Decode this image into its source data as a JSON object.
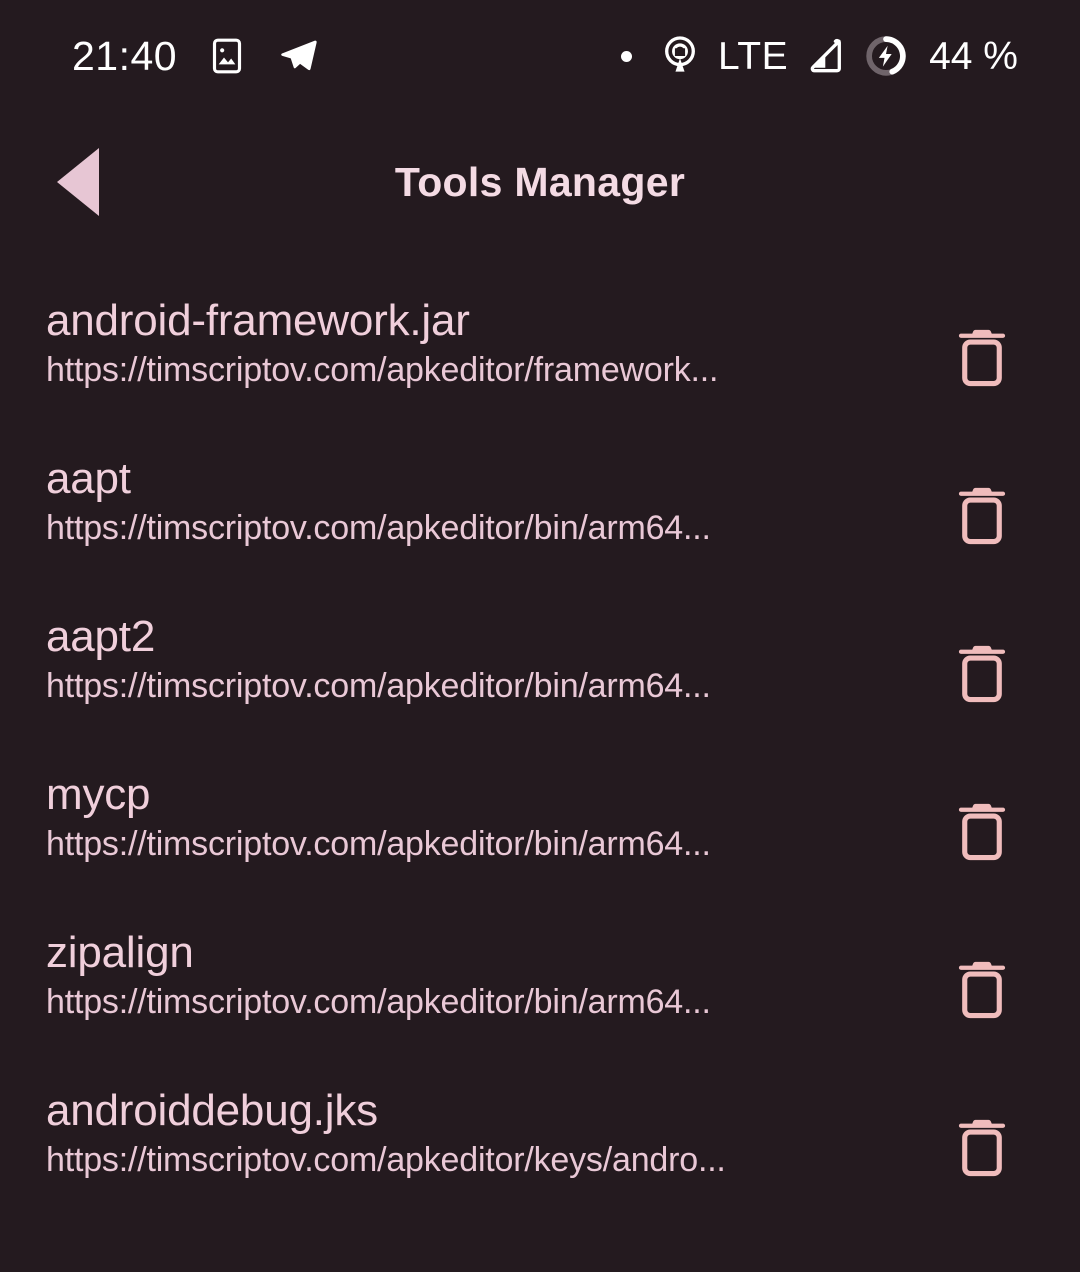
{
  "status_bar": {
    "clock": "21:40",
    "left_icons": [
      {
        "name": "image-icon"
      },
      {
        "name": "telegram-icon"
      }
    ],
    "right_icons": [
      {
        "name": "notification-dot-icon"
      },
      {
        "name": "hotspot-icon"
      },
      {
        "name": "signal-icon"
      },
      {
        "name": "battery-charging-icon"
      }
    ],
    "network_type": "LTE",
    "battery_percent": "44 %",
    "battery_level": 44,
    "icon_color": "#ffffff"
  },
  "app_bar": {
    "back_label": "back-arrow",
    "title": "Tools Manager",
    "title_color": "#f4dbe4",
    "accent_color": "#e7c6d4"
  },
  "theme": {
    "background": "#241a1f",
    "primary_text": "#f0cfdb",
    "secondary_text": "#e9c8d6",
    "icon_accent": "#f0bcbc"
  },
  "tools": [
    {
      "name": "android-framework.jar",
      "url": "https://timscriptov.com/apkeditor/framework...",
      "delete_label": "delete-icon"
    },
    {
      "name": "aapt",
      "url": "https://timscriptov.com/apkeditor/bin/arm64...",
      "delete_label": "delete-icon"
    },
    {
      "name": "aapt2",
      "url": "https://timscriptov.com/apkeditor/bin/arm64...",
      "delete_label": "delete-icon"
    },
    {
      "name": "mycp",
      "url": "https://timscriptov.com/apkeditor/bin/arm64...",
      "delete_label": "delete-icon"
    },
    {
      "name": "zipalign",
      "url": "https://timscriptov.com/apkeditor/bin/arm64...",
      "delete_label": "delete-icon"
    },
    {
      "name": "androiddebug.jks",
      "url": "https://timscriptov.com/apkeditor/keys/andro...",
      "delete_label": "delete-icon"
    }
  ]
}
